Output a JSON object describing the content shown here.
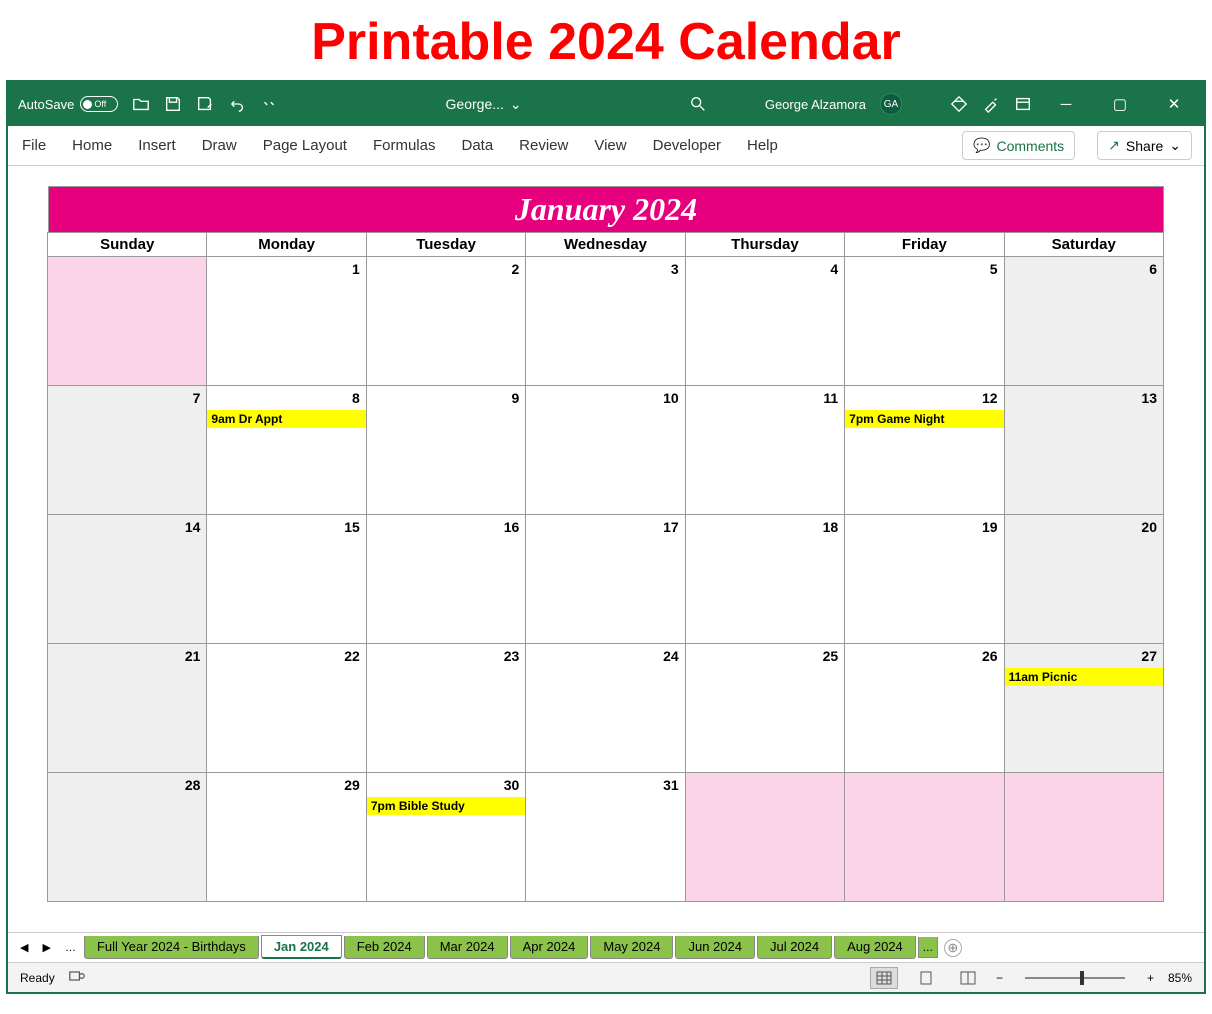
{
  "pageTitle": "Printable 2024 Calendar",
  "titlebar": {
    "autosave_label": "AutoSave",
    "autosave_state": "Off",
    "doc_name": "George...",
    "user_name": "George Alzamora",
    "user_initials": "GA"
  },
  "ribbon": {
    "tabs": [
      "File",
      "Home",
      "Insert",
      "Draw",
      "Page Layout",
      "Formulas",
      "Data",
      "Review",
      "View",
      "Developer",
      "Help"
    ],
    "comments": "Comments",
    "share": "Share"
  },
  "calendar": {
    "month_title": "January 2024",
    "day_headers": [
      "Sunday",
      "Monday",
      "Tuesday",
      "Wednesday",
      "Thursday",
      "Friday",
      "Saturday"
    ],
    "weeks": [
      [
        {
          "n": "",
          "pink": true,
          "wk": false
        },
        {
          "n": "1"
        },
        {
          "n": "2"
        },
        {
          "n": "3"
        },
        {
          "n": "4"
        },
        {
          "n": "5"
        },
        {
          "n": "6",
          "wk": true
        }
      ],
      [
        {
          "n": "7",
          "wk": true
        },
        {
          "n": "8",
          "ev": "9am Dr Appt"
        },
        {
          "n": "9"
        },
        {
          "n": "10"
        },
        {
          "n": "11"
        },
        {
          "n": "12",
          "ev": "7pm Game Night"
        },
        {
          "n": "13",
          "wk": true
        }
      ],
      [
        {
          "n": "14",
          "wk": true
        },
        {
          "n": "15"
        },
        {
          "n": "16"
        },
        {
          "n": "17"
        },
        {
          "n": "18"
        },
        {
          "n": "19"
        },
        {
          "n": "20",
          "wk": true
        }
      ],
      [
        {
          "n": "21",
          "wk": true
        },
        {
          "n": "22"
        },
        {
          "n": "23"
        },
        {
          "n": "24"
        },
        {
          "n": "25"
        },
        {
          "n": "26"
        },
        {
          "n": "27",
          "wk": true,
          "ev": "11am Picnic"
        }
      ],
      [
        {
          "n": "28",
          "wk": true
        },
        {
          "n": "29"
        },
        {
          "n": "30",
          "ev": "7pm Bible Study"
        },
        {
          "n": "31"
        },
        {
          "n": "",
          "pink": true
        },
        {
          "n": "",
          "pink": true
        },
        {
          "n": "",
          "pink": true
        }
      ]
    ]
  },
  "sheets": {
    "tabs": [
      "Full Year 2024 - Birthdays",
      "Jan 2024",
      "Feb 2024",
      "Mar 2024",
      "Apr 2024",
      "May 2024",
      "Jun 2024",
      "Jul 2024",
      "Aug 2024"
    ],
    "active": "Jan 2024",
    "ellipsis_left": "…",
    "more": "..."
  },
  "status": {
    "ready": "Ready",
    "zoom": "85%"
  }
}
